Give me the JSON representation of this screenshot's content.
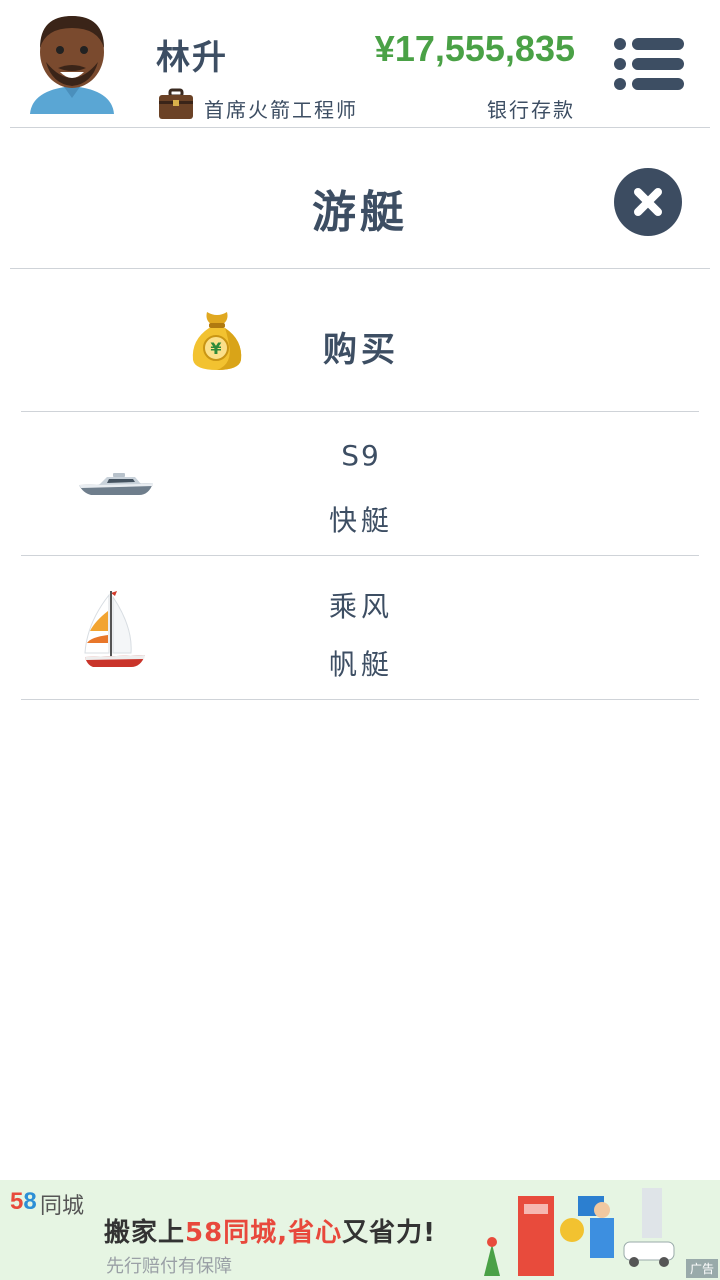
{
  "header": {
    "player_name": "林升",
    "job_title": "首席火箭工程师",
    "balance": "¥17,555,835",
    "balance_label": "银行存款",
    "balance_color": "#4aa146"
  },
  "page": {
    "title": "游艇"
  },
  "items": [
    {
      "icon": "money-bag-icon",
      "label": "购买"
    },
    {
      "icon": "speedboat-icon",
      "name": "S9",
      "type": "快艇"
    },
    {
      "icon": "sailboat-icon",
      "name": "乘风",
      "type": "帆艇"
    }
  ],
  "ad": {
    "brand_num": "58",
    "brand_text": "同城",
    "headline_prefix": "搬家上",
    "headline_highlight": "58同城,省心",
    "headline_suffix": "又省力!",
    "subline": "先行赔付有保障",
    "tag": "广告"
  }
}
